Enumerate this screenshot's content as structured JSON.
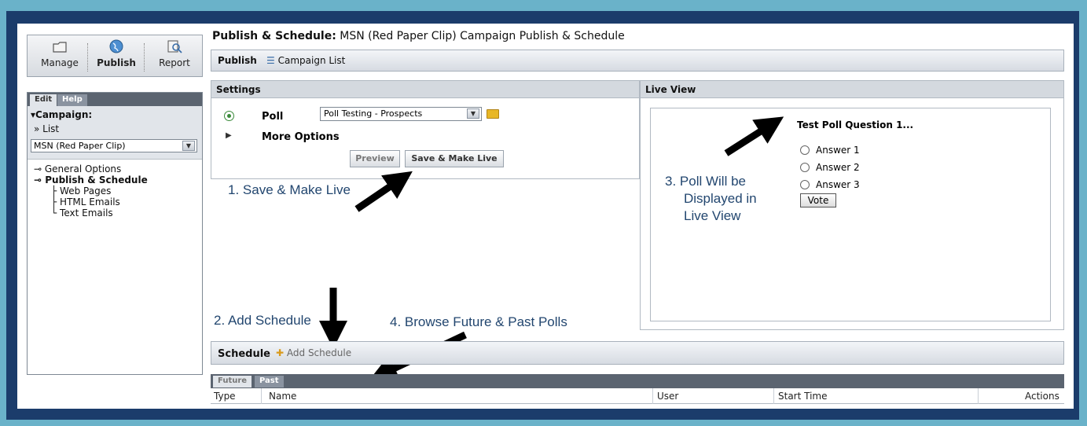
{
  "toolbar": {
    "manage_label": "Manage",
    "publish_label": "Publish",
    "report_label": "Report"
  },
  "sidebar": {
    "tabs": {
      "edit": "Edit",
      "help": "Help"
    },
    "campaign_title": "Campaign:",
    "list_link": "» List",
    "campaign_select": "MSN (Red Paper Clip)",
    "tree": {
      "general_options": "General Options",
      "publish_schedule": "Publish & Schedule",
      "web_pages": "Web Pages",
      "html_emails": "HTML Emails",
      "text_emails": "Text Emails"
    }
  },
  "header": {
    "title_bold": "Publish & Schedule:",
    "title_rest": "MSN (Red Paper Clip) Campaign Publish & Schedule"
  },
  "publish_bar": {
    "label": "Publish",
    "campaign_list": "Campaign List"
  },
  "settings": {
    "title": "Settings",
    "poll_label": "Poll",
    "poll_select": "Poll Testing - Prospects",
    "more_options": "More Options",
    "preview_button": "Preview",
    "save_live_button": "Save & Make Live"
  },
  "live_view": {
    "title": "Live View",
    "question": "Test Poll Question 1...",
    "answers": [
      "Answer 1",
      "Answer 2",
      "Answer 3"
    ],
    "vote_button": "Vote"
  },
  "annotations": {
    "step1": "1. Save & Make Live",
    "step2": "2. Add Schedule",
    "step3_line1": "3. Poll Will be",
    "step3_line2": "Displayed in",
    "step3_line3": "Live View",
    "step4": "4. Browse Future & Past Polls"
  },
  "schedule": {
    "label": "Schedule",
    "add_schedule": "Add Schedule",
    "tabs": {
      "future": "Future",
      "past": "Past"
    },
    "columns": [
      "Type",
      "Name",
      "User",
      "Start Time",
      "Actions"
    ]
  },
  "colors": {
    "outer_background": "#6ab2c9",
    "frame": "#1b3c6b",
    "annotation_text": "#22466f",
    "dark_tab": "#5b6470"
  }
}
